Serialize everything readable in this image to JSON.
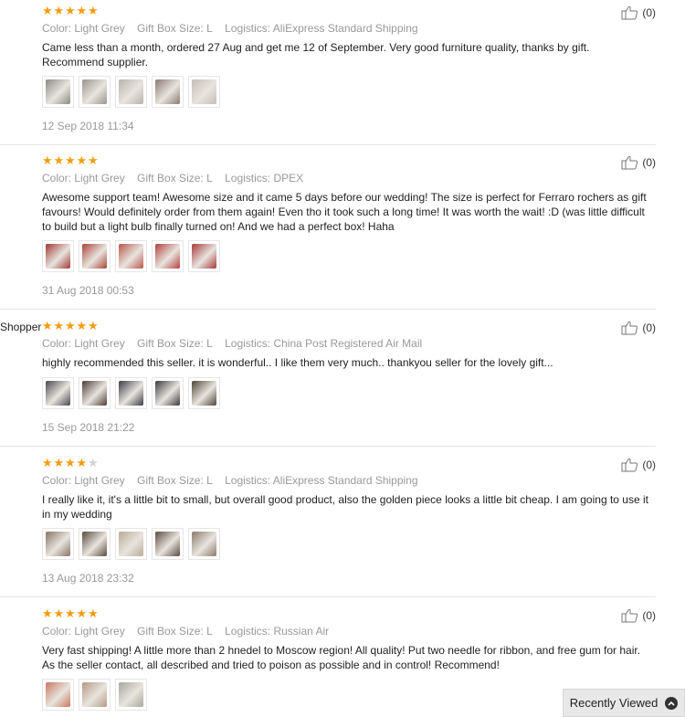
{
  "reviews": [
    {
      "reviewer": "",
      "rating": 5,
      "color": "Color: Light Grey",
      "size": "Gift Box Size: L",
      "logistics": "Logistics: AliExpress Standard Shipping",
      "text": "Came less than a month, ordered 27 Aug and get me 12 of September. Very good furniture quality, thanks by gift. Recommend supplier.",
      "photo_colors": [
        "#8b8b86",
        "#9a958c",
        "#b8b4ad",
        "#8a7a70",
        "#c4bdb5"
      ],
      "date": "12 Sep 2018 11:34",
      "likes": "(0)"
    },
    {
      "reviewer": "",
      "rating": 5,
      "color": "Color: Light Grey",
      "size": "Gift Box Size: L",
      "logistics": "Logistics: DPEX",
      "text": "Awesome support team! Awesome size and it came 5 days before our wedding! The size is perfect for Ferraro rochers as gift favours! Would definitely order from them again! Even tho it took such a long time! It was worth the wait! :D (was little difficult to build but a light bulb finally turned on! And we had a perfect box! Haha",
      "photo_colors": [
        "#9e3a35",
        "#a8453a",
        "#b8584c",
        "#b2413e",
        "#a63a3a"
      ],
      "date": "31 Aug 2018 00:53",
      "likes": "(0)"
    },
    {
      "reviewer": "Shopper",
      "rating": 5,
      "color": "Color: Light Grey",
      "size": "Gift Box Size: L",
      "logistics": "Logistics: China Post Registered Air Mail",
      "text": "highly recommended this seller. it is wonderful.. I like them very much.. thankyou seller for the lovely gift...",
      "photo_colors": [
        "#4a4a52",
        "#4e3c36",
        "#3b3d45",
        "#3a3a40",
        "#4b4636"
      ],
      "date": "15 Sep 2018 21:22",
      "likes": "(0)"
    },
    {
      "reviewer": "",
      "rating": 4,
      "color": "Color: Light Grey",
      "size": "Gift Box Size: L",
      "logistics": "Logistics: AliExpress Standard Shipping",
      "text": "I really like it, it's a little bit to small, but overall good product, also the golden piece looks a little bit cheap. I am going to use it in my wedding",
      "photo_colors": [
        "#8a7466",
        "#5a4a3c",
        "#b9ab96",
        "#5c4a40",
        "#8e7a6a"
      ],
      "date": "13 Aug 2018 23:32",
      "likes": "(0)"
    },
    {
      "reviewer": "",
      "rating": 5,
      "color": "Color: Light Grey",
      "size": "Gift Box Size: L",
      "logistics": "Logistics: Russian Air",
      "text": "Very fast shipping! A little more than 2 hnedel to Moscow region! All quality! Put two needle for ribbon, and free gum for hair. As the seller contact, all described and tried to poison as possible and in control! Recommend!",
      "photo_colors": [
        "#c9785e",
        "#b49a86",
        "#a8a6a0"
      ],
      "date": "",
      "likes": "(0)"
    }
  ],
  "recently_viewed": {
    "label": "Recently Viewed"
  }
}
